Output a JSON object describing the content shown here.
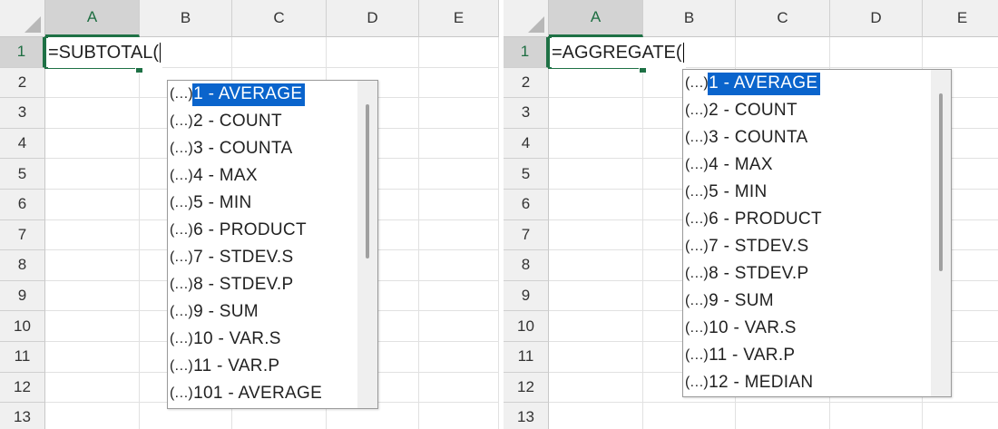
{
  "left_sheet": {
    "formula": "=SUBTOTAL(",
    "columns": [
      "A",
      "B",
      "C",
      "D",
      "E"
    ],
    "rows": [
      "1",
      "2",
      "3",
      "4",
      "5",
      "6",
      "7",
      "8",
      "9",
      "10",
      "11",
      "12",
      "13"
    ],
    "selected_cell": "A1",
    "dropdown_items": [
      {
        "icon": "(…)",
        "label": "1 - AVERAGE",
        "selected": true
      },
      {
        "icon": "(…)",
        "label": "2 - COUNT"
      },
      {
        "icon": "(…)",
        "label": "3 - COUNTA"
      },
      {
        "icon": "(…)",
        "label": "4 - MAX"
      },
      {
        "icon": "(…)",
        "label": "5 - MIN"
      },
      {
        "icon": "(…)",
        "label": "6 - PRODUCT"
      },
      {
        "icon": "(…)",
        "label": "7 - STDEV.S"
      },
      {
        "icon": "(…)",
        "label": "8 - STDEV.P"
      },
      {
        "icon": "(…)",
        "label": "9 - SUM"
      },
      {
        "icon": "(…)",
        "label": "10 - VAR.S"
      },
      {
        "icon": "(…)",
        "label": "11 - VAR.P"
      },
      {
        "icon": "(…)",
        "label": "101 - AVERAGE"
      }
    ]
  },
  "right_sheet": {
    "formula": "=AGGREGATE(",
    "columns": [
      "A",
      "B",
      "C",
      "D",
      "E"
    ],
    "rows": [
      "1",
      "2",
      "3",
      "4",
      "5",
      "6",
      "7",
      "8",
      "9",
      "10",
      "11",
      "12",
      "13"
    ],
    "selected_cell": "A1",
    "dropdown_items": [
      {
        "icon": "(…)",
        "label": "1 - AVERAGE",
        "selected": true
      },
      {
        "icon": "(…)",
        "label": "2 - COUNT"
      },
      {
        "icon": "(…)",
        "label": "3 - COUNTA"
      },
      {
        "icon": "(…)",
        "label": "4 - MAX"
      },
      {
        "icon": "(…)",
        "label": "5 - MIN"
      },
      {
        "icon": "(…)",
        "label": "6 - PRODUCT"
      },
      {
        "icon": "(…)",
        "label": "7 - STDEV.S"
      },
      {
        "icon": "(…)",
        "label": "8 - STDEV.P"
      },
      {
        "icon": "(…)",
        "label": "9 - SUM"
      },
      {
        "icon": "(…)",
        "label": "10 - VAR.S"
      },
      {
        "icon": "(…)",
        "label": "11 - VAR.P"
      },
      {
        "icon": "(…)",
        "label": "12 - MEDIAN"
      }
    ]
  },
  "colors": {
    "accent_green": "#1e7145",
    "selection_blue": "#0a64cc",
    "header_bg": "#f0f0f0"
  },
  "icons": {
    "dropdown_item_icon": "function-argument-icon"
  }
}
